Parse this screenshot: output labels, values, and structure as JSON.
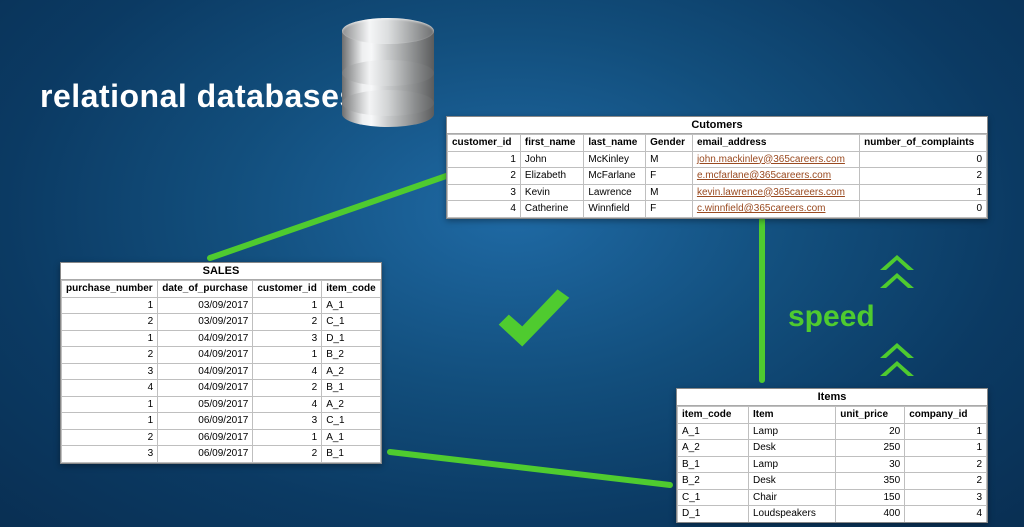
{
  "title": "relational databases",
  "speed_label": "speed",
  "tables": {
    "sales": {
      "caption": "SALES",
      "headers": [
        "purchase_number",
        "date_of_purchase",
        "customer_id",
        "item_code"
      ],
      "rows": [
        [
          "1",
          "03/09/2017",
          "1",
          "A_1"
        ],
        [
          "2",
          "03/09/2017",
          "2",
          "C_1"
        ],
        [
          "1",
          "04/09/2017",
          "3",
          "D_1"
        ],
        [
          "2",
          "04/09/2017",
          "1",
          "B_2"
        ],
        [
          "3",
          "04/09/2017",
          "4",
          "A_2"
        ],
        [
          "4",
          "04/09/2017",
          "2",
          "B_1"
        ],
        [
          "1",
          "05/09/2017",
          "4",
          "A_2"
        ],
        [
          "1",
          "06/09/2017",
          "3",
          "C_1"
        ],
        [
          "2",
          "06/09/2017",
          "1",
          "A_1"
        ],
        [
          "3",
          "06/09/2017",
          "2",
          "B_1"
        ]
      ]
    },
    "customers": {
      "caption": "Cutomers",
      "headers": [
        "customer_id",
        "first_name",
        "last_name",
        "Gender",
        "email_address",
        "number_of_complaints"
      ],
      "rows": [
        [
          "1",
          "John",
          "McKinley",
          "M",
          "john.mackinley@365careers.com",
          "0"
        ],
        [
          "2",
          "Elizabeth",
          "McFarlane",
          "F",
          "e.mcfarlane@365careers.com",
          "2"
        ],
        [
          "3",
          "Kevin",
          "Lawrence",
          "M",
          "kevin.lawrence@365careers.com",
          "1"
        ],
        [
          "4",
          "Catherine",
          "Winnfield",
          "F",
          "c.winnfield@365careers.com",
          "0"
        ]
      ]
    },
    "items": {
      "caption": "Items",
      "headers": [
        "item_code",
        "Item",
        "unit_price",
        "company_id"
      ],
      "rows": [
        [
          "A_1",
          "Lamp",
          "20",
          "1"
        ],
        [
          "A_2",
          "Desk",
          "250",
          "1"
        ],
        [
          "B_1",
          "Lamp",
          "30",
          "2"
        ],
        [
          "B_2",
          "Desk",
          "350",
          "2"
        ],
        [
          "C_1",
          "Chair",
          "150",
          "3"
        ],
        [
          "D_1",
          "Loudspeakers",
          "400",
          "4"
        ]
      ]
    }
  },
  "colors": {
    "accent": "#4fcb2f",
    "link": "#9a4a20"
  }
}
